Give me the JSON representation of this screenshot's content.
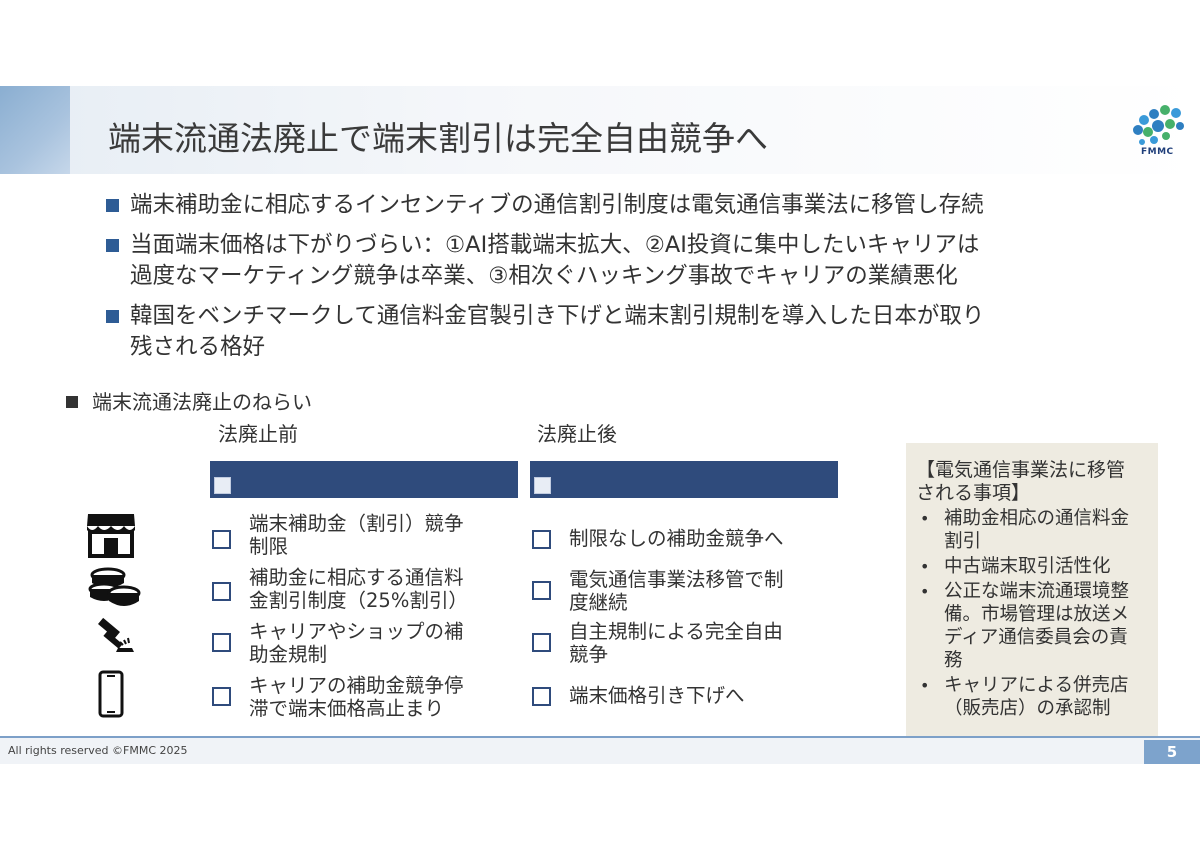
{
  "slide": {
    "title": "端末流通法廃止で端末割引は完全自由競争へ",
    "logo_text": "FMMC",
    "bullets": [
      "端末補助金に相応するインセンティブの通信割引制度は電気通信事業法に移管し存続",
      "当面端末価格は下がりづらい：①AI搭載端末拡大、②AI投資に集中したいキャリアは",
      "過度なマーケティング競争は卒業、③相次ぐハッキング事故でキャリアの業績悪化",
      "韓国をベンチマークして通信料金官製引き下げと端末割引規制を導入した日本が取り",
      "残される格好"
    ],
    "section_title": "端末流通法廃止のねらい",
    "before": {
      "label": "法廃止前",
      "items": [
        [
          "端末補助金（割引）競争",
          "制限"
        ],
        [
          "補助金に相応する通信料",
          "金割引制度（25%割引）"
        ],
        [
          "キャリアやショップの補",
          "助金規制"
        ],
        [
          "キャリアの補助金競争停",
          "滞で端末価格高止まり"
        ]
      ]
    },
    "after": {
      "label": "法廃止後",
      "items": [
        [
          "制限なしの補助金競争へ"
        ],
        [
          "電気通信事業法移管で制",
          "度継続"
        ],
        [
          "自主規制による完全自由",
          "競争"
        ],
        [
          "端末価格引き下げへ"
        ]
      ]
    },
    "icons": [
      "store-icon",
      "coins-icon",
      "gavel-icon",
      "smartphone-icon"
    ],
    "note": {
      "title_lines": [
        "【電気通信事業法に移管",
        "される事項】"
      ],
      "items": [
        [
          "補助金相応の通信料金",
          "割引"
        ],
        [
          "中古端末取引活性化"
        ],
        [
          "公正な端末流通環境整",
          "備。市場管理は放送メ",
          "ディア通信委員会の責",
          "務"
        ],
        [
          "キャリアによる併売店",
          "（販売店）の承認制"
        ]
      ]
    },
    "footer": {
      "copyright": "All rights reserved ©FMMC 2025",
      "page_number": "5"
    },
    "colors": {
      "accent_blue": "#2e5c95",
      "header_bar_navy": "#2f4b7c",
      "note_bg": "#eeebe1"
    }
  }
}
